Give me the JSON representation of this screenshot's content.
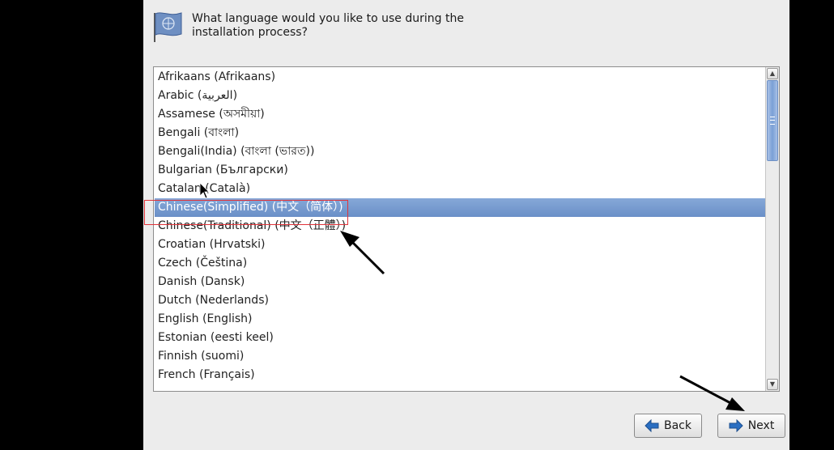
{
  "prompt": {
    "line1": "What language would you like to use during the",
    "line2": "installation process?"
  },
  "languages": [
    "Afrikaans (Afrikaans)",
    "Arabic (العربية)",
    "Assamese (অসমীয়া)",
    "Bengali (বাংলা)",
    "Bengali(India) (বাংলা (ভারত))",
    "Bulgarian (Български)",
    "Catalan (Català)",
    "Chinese(Simplified) (中文（简体）)",
    "Chinese(Traditional) (中文（正體）)",
    "Croatian (Hrvatski)",
    "Czech (Čeština)",
    "Danish (Dansk)",
    "Dutch (Nederlands)",
    "English (English)",
    "Estonian (eesti keel)",
    "Finnish (suomi)",
    "French (Français)"
  ],
  "selected_language": "Chinese(Simplified) (中文（简体）)",
  "buttons": {
    "back": "Back",
    "next": "Next"
  },
  "icons": {
    "header": "flag-icon",
    "back": "arrow-left-icon",
    "next": "arrow-right-icon"
  },
  "colors": {
    "selection": "#7398cf",
    "annotation_box": "#e0343a",
    "annotation_arrow": "#000000",
    "button_arrow": "#2b6fc2"
  }
}
